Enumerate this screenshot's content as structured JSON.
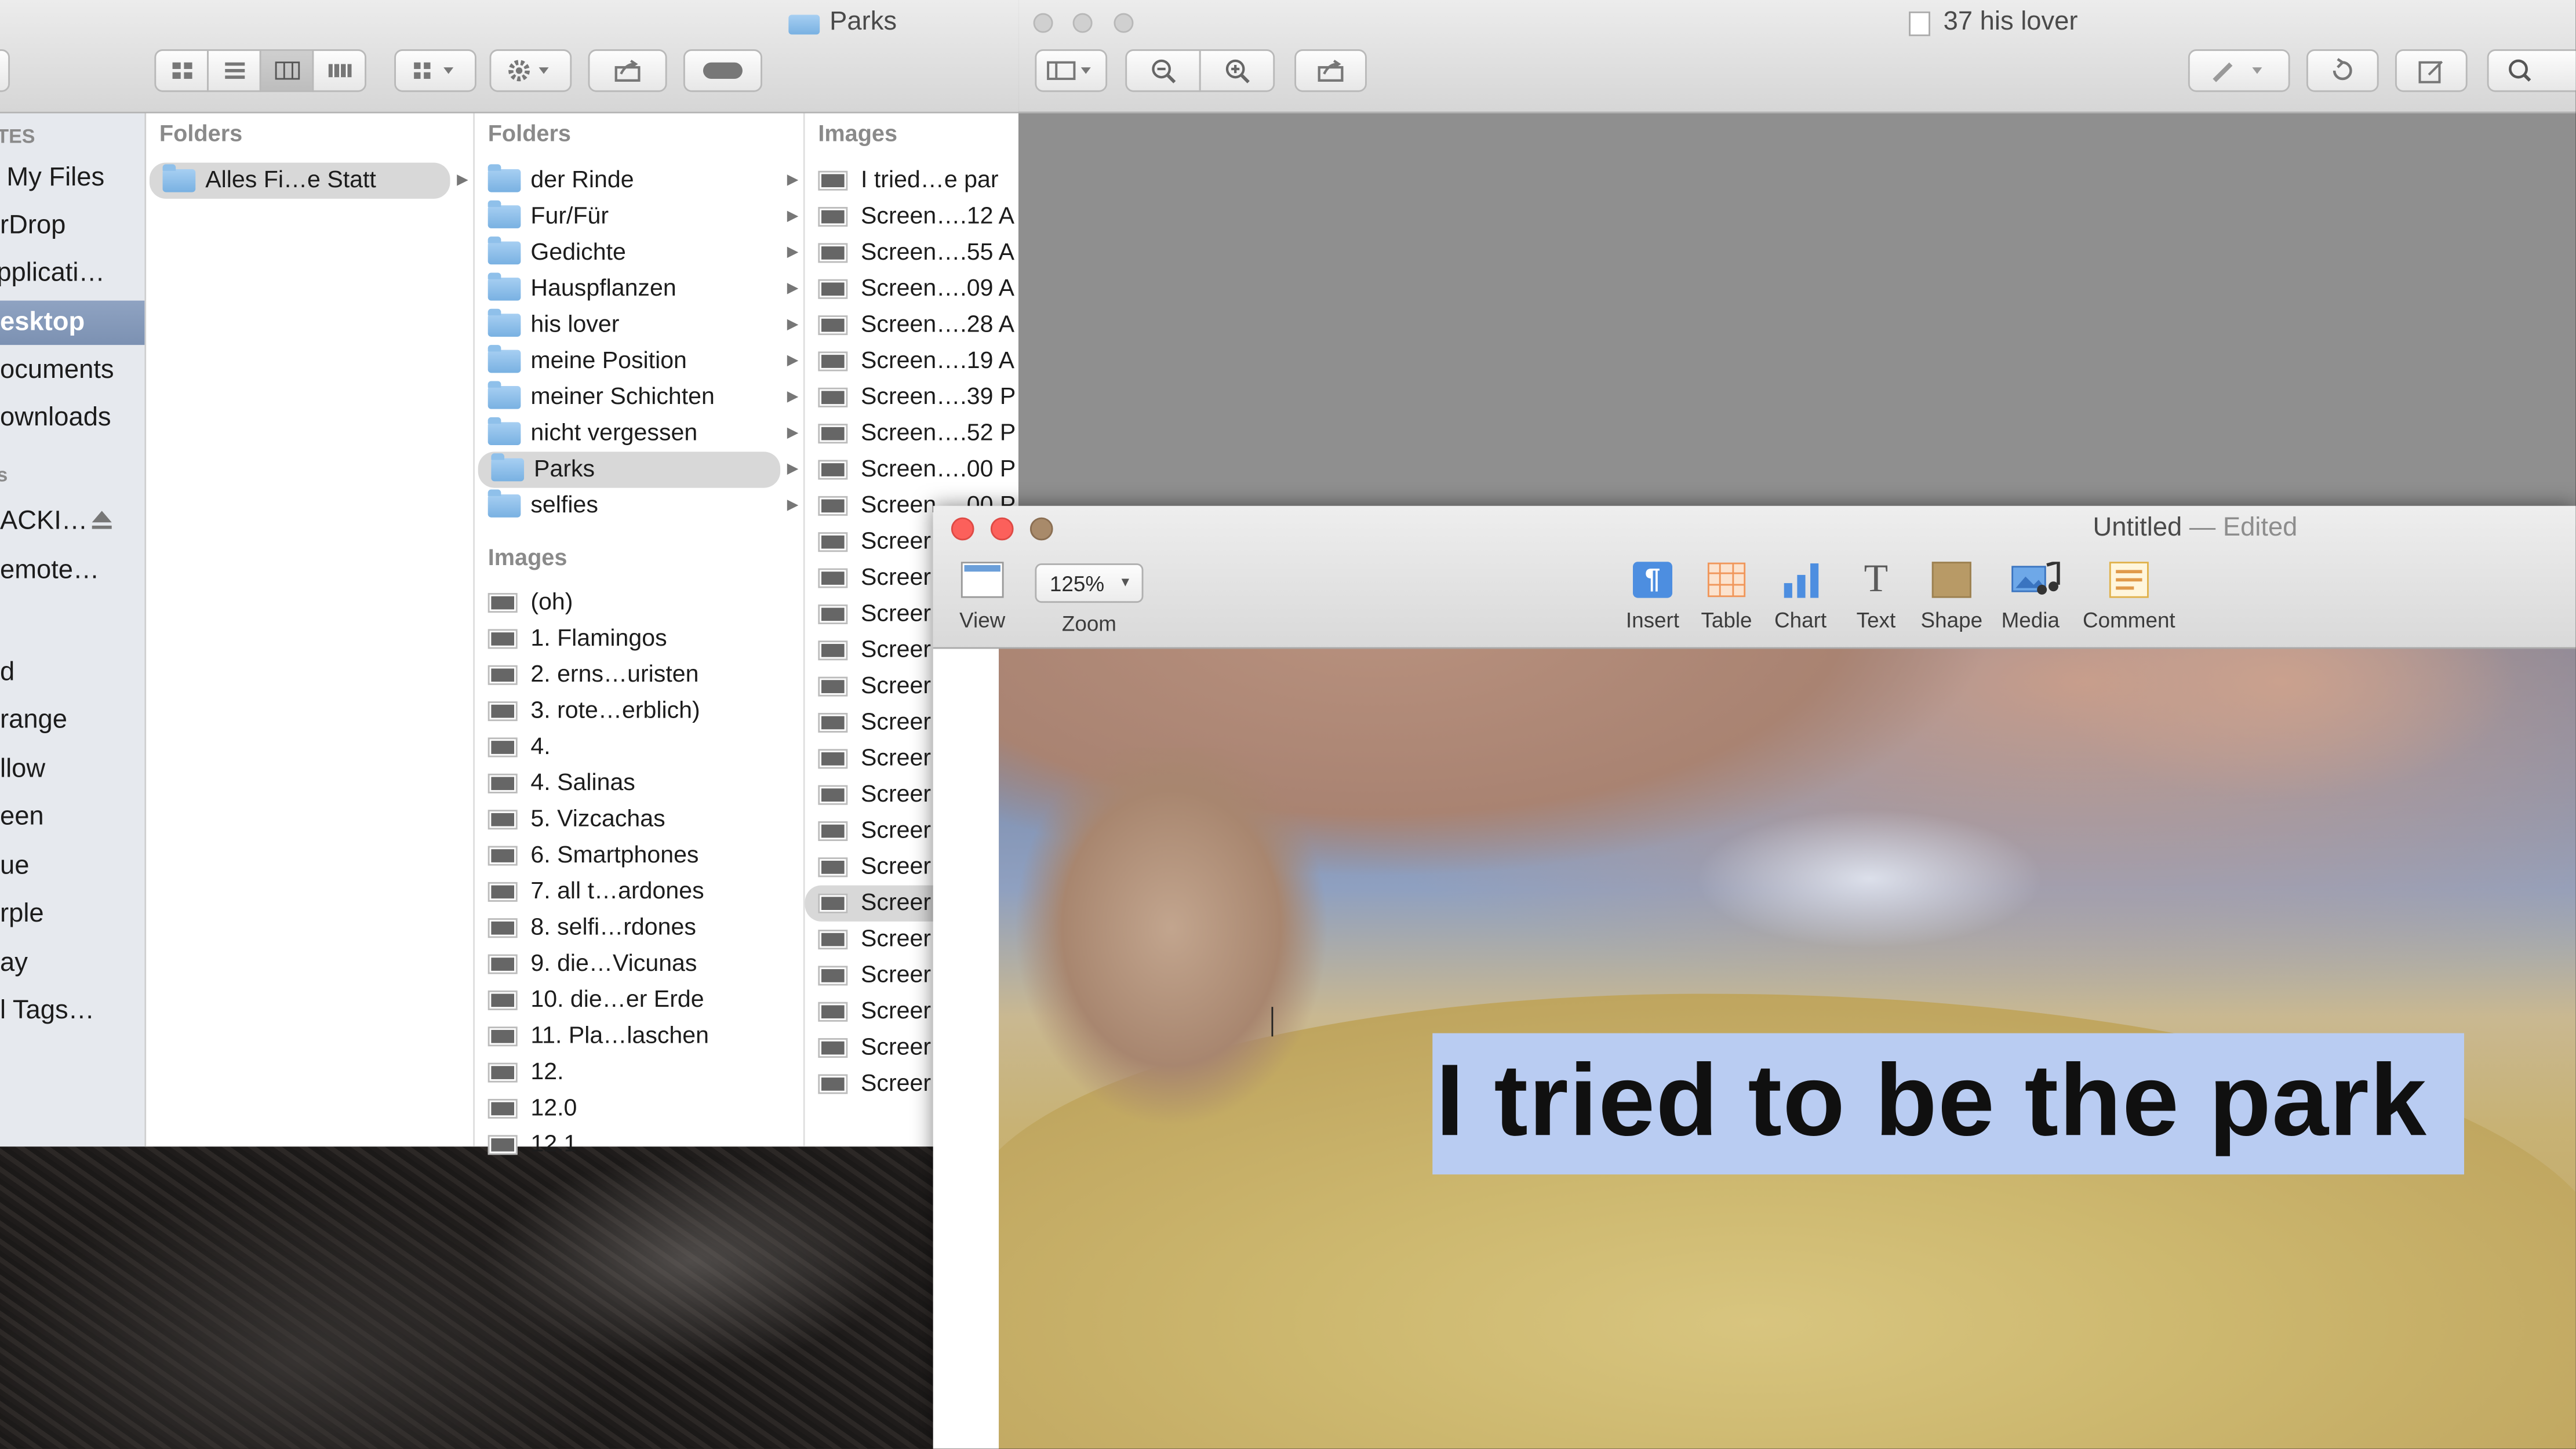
{
  "finder": {
    "title": "Parks",
    "sidebar": {
      "section_header": "TES",
      "items": [
        {
          "label": "l My Files"
        },
        {
          "label": "rDrop"
        },
        {
          "label": "pplicati…"
        },
        {
          "label": "esktop",
          "selected": true
        },
        {
          "label": "ocuments"
        },
        {
          "label": "ownloads"
        },
        {
          "label": "s"
        },
        {
          "label": "ACKI…"
        },
        {
          "label": "emote…"
        },
        {
          "label": "d"
        },
        {
          "label": "range"
        },
        {
          "label": "llow"
        },
        {
          "label": "een"
        },
        {
          "label": "ue"
        },
        {
          "label": "rple"
        },
        {
          "label": "ay"
        },
        {
          "label": "l Tags…"
        }
      ]
    },
    "column1": {
      "header": "Folders",
      "items": [
        "Alles Fi…e Statt"
      ]
    },
    "column2": {
      "folders_header": "Folders",
      "folders": [
        "der Rinde",
        "Fur/Für",
        "Gedichte",
        "Hauspflanzen",
        "his lover",
        "meine Position",
        "meiner Schichten",
        "nicht vergessen",
        "Parks",
        "selfies"
      ],
      "selected_folder": "Parks",
      "images_header": "Images",
      "images": [
        "(oh)",
        "1. Flamingos",
        "2. erns…uristen",
        "3. rote…erblich)",
        "4.",
        "4. Salinas",
        "5. Vizcachas",
        "6. Smartphones",
        "7. all t…ardones",
        "8. selfi…rdones",
        "9. die…Vicunas",
        "10. die…er Erde",
        "11. Pla…laschen",
        "12.",
        "12.0",
        "12.1"
      ]
    },
    "column3": {
      "header": "Images",
      "items": [
        "I tried…e par",
        "Screen….12 A",
        "Screen….55 A",
        "Screen….09 A",
        "Screen….28 A",
        "Screen….19 A",
        "Screen….39 P",
        "Screen….52 P",
        "Screen….00 P",
        "Screen….00 P",
        "Screer",
        "Screer",
        "Screer",
        "Screer",
        "Screer",
        "Screer",
        "Screer",
        "Screer",
        "Screer",
        "Screer",
        "Screer",
        "Screer",
        "Screer",
        "Screer",
        "Screer",
        "Screer"
      ]
    }
  },
  "preview": {
    "title": "37 his lover"
  },
  "pages": {
    "title": "Untitled",
    "status": "— Edited",
    "zoom": "125%",
    "tools": {
      "view": "View",
      "zoom": "Zoom",
      "insert": "Insert",
      "table": "Table",
      "chart": "Chart",
      "text": "Text",
      "shape": "Shape",
      "media": "Media",
      "comment": "Comment"
    },
    "document_text": "I tried to be the park"
  },
  "colors": {
    "selection_highlight": "#b9ccf2",
    "sidebar_selected": "#7c91b2",
    "close_red": "#fc605b",
    "minimize_yellow": "#fdbc40"
  }
}
